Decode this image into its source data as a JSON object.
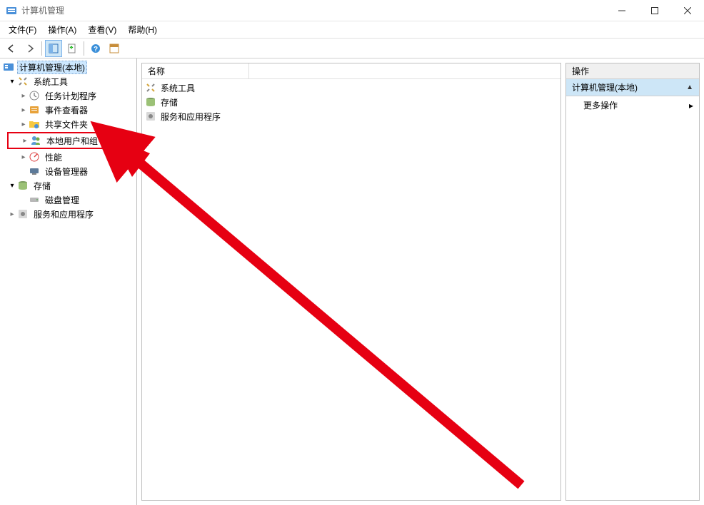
{
  "window": {
    "title": "计算机管理"
  },
  "menubar": {
    "file": "文件(F)",
    "action": "操作(A)",
    "view": "查看(V)",
    "help": "帮助(H)"
  },
  "tree": {
    "root": "计算机管理(本地)",
    "system_tools": "系统工具",
    "task_scheduler": "任务计划程序",
    "event_viewer": "事件查看器",
    "shared_folders": "共享文件夹",
    "local_users_groups": "本地用户和组",
    "performance": "性能",
    "device_manager": "设备管理器",
    "storage": "存储",
    "disk_management": "磁盘管理",
    "services_apps": "服务和应用程序"
  },
  "list": {
    "header_name": "名称",
    "rows": {
      "system_tools": "系统工具",
      "storage": "存储",
      "services_apps": "服务和应用程序"
    }
  },
  "actions": {
    "header": "操作",
    "group_title": "计算机管理(本地)",
    "more_actions": "更多操作"
  }
}
